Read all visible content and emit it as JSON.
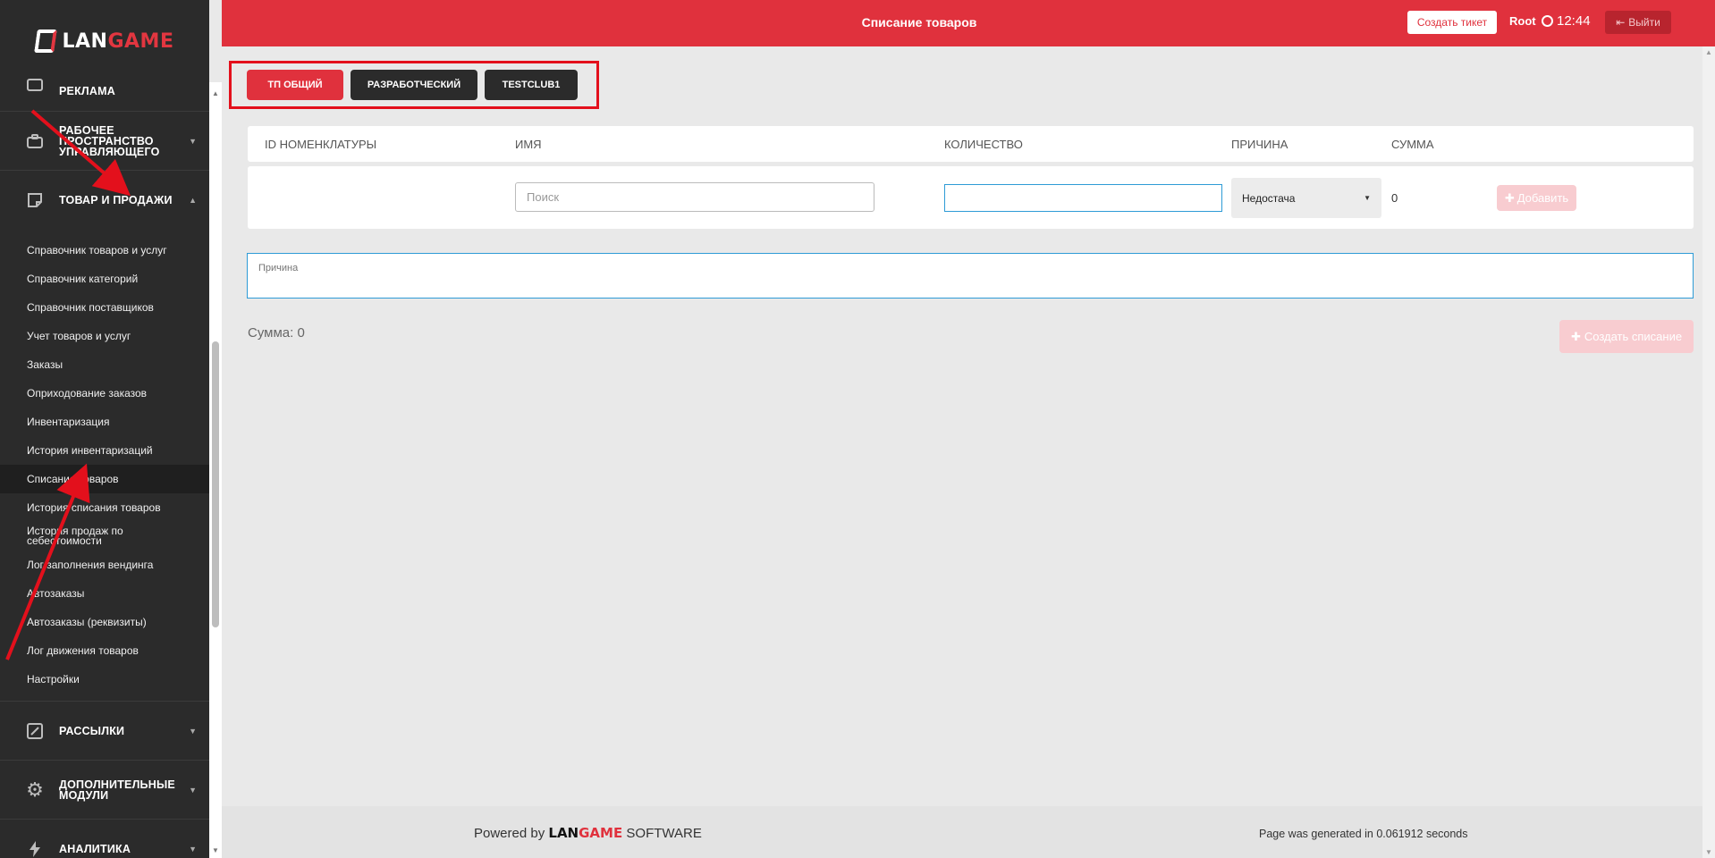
{
  "brand": {
    "logo_lan": "LAN",
    "logo_game": "GAME"
  },
  "sidebar": {
    "top_partial": "РЕКЛАМА",
    "sections": [
      {
        "label": "РАБОЧЕЕ ПРОСТРАНСТВО УПРАВЛЯЮЩЕГО",
        "icon": "briefcase-icon"
      },
      {
        "label": "ТОВАР И ПРОДАЖИ",
        "icon": "sticky-note-icon"
      }
    ],
    "items": [
      {
        "label": "Справочник товаров и услуг"
      },
      {
        "label": "Справочник категорий"
      },
      {
        "label": "Справочник поставщиков"
      },
      {
        "label": "Учет товаров и услуг"
      },
      {
        "label": "Заказы"
      },
      {
        "label": "Оприходование заказов"
      },
      {
        "label": "Инвентаризация"
      },
      {
        "label": "История инвентаризаций"
      },
      {
        "label": "Списание товаров"
      },
      {
        "label": "История списания товаров"
      },
      {
        "label": "История продаж по себестоимости"
      },
      {
        "label": "Лог заполнения вендинга"
      },
      {
        "label": "Автозаказы"
      },
      {
        "label": "Автозаказы (реквизиты)"
      },
      {
        "label": "Лог движения товаров"
      },
      {
        "label": "Настройки"
      }
    ],
    "bottom_sections": [
      {
        "label": "РАССЫЛКИ",
        "icon": "edit-icon"
      },
      {
        "label": "ДОПОЛНИТЕЛЬНЫЕ МОДУЛИ",
        "icon": "gear-icon"
      },
      {
        "label": "АНАЛИТИКА",
        "icon": "bolt-icon"
      }
    ]
  },
  "header": {
    "title": "Списание товаров",
    "ticket_button": "Создать тикет",
    "user": "Root",
    "time": "12:44",
    "logout_button": "Выйти"
  },
  "clubs": [
    {
      "label": "ТП ОБЩИЙ",
      "active": true
    },
    {
      "label": "РАЗРАБОТЧЕСКИЙ",
      "active": false
    },
    {
      "label": "TESTCLUB1",
      "active": false
    }
  ],
  "table": {
    "headers": [
      "ID НОМЕНКЛАТУРЫ",
      "ИМЯ",
      "КОЛИЧЕСТВО",
      "ПРИЧИНА",
      "СУММА"
    ],
    "row": {
      "search_placeholder": "Поиск",
      "quantity": "",
      "reason": "Недостача",
      "sum": "0",
      "add_button": "Добавить"
    }
  },
  "reason_placeholder": "Причина",
  "total": "Сумма: 0",
  "create_button": "Создать списание",
  "footer": {
    "powered_prefix": "Powered by",
    "powered_lan": "LAN",
    "powered_game": "GAME",
    "powered_suffix": "SOFTWARE",
    "generated": "Page was generated in 0.061912 seconds"
  },
  "colors": {
    "accent": "#e0313d",
    "sidebar": "#2b2b2b",
    "annotation": "#e3101c"
  }
}
